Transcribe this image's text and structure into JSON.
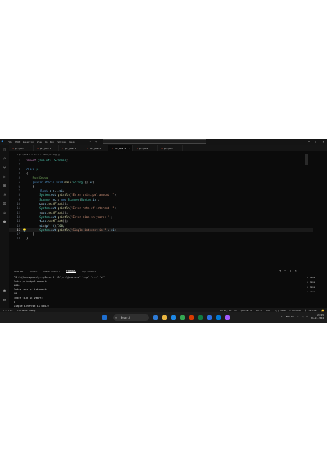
{
  "menu": [
    "File",
    "Edit",
    "Selection",
    "View",
    "Go",
    "Run",
    "Terminal",
    "Help"
  ],
  "tabs": [
    {
      "label": "p1.java"
    },
    {
      "label": "p4.java 1"
    },
    {
      "label": "p3.java 1"
    },
    {
      "label": "p6.java 1"
    },
    {
      "label": "p7.java 1"
    },
    {
      "label": "p5.java"
    },
    {
      "label": "p8.java"
    }
  ],
  "active_tab_index": 4,
  "breadcrumb": "J p7.java > ⚙ p7 > ⊕ main(String[])",
  "code_lines": [
    {
      "n": "1",
      "html": "<span class=\"kw2\">import</span> <span class=\"ty\">java.util.Scanner</span>;"
    },
    {
      "n": "2",
      "html": ""
    },
    {
      "n": "3",
      "html": "<span class=\"kw\">class</span> <span class=\"ty\">p7</span>"
    },
    {
      "n": "4",
      "html": "{"
    },
    {
      "n": "5",
      "html": "    <span class=\"cmt\">Run|Debug</span>"
    },
    {
      "n": "5",
      "html": "    <span class=\"kw\">public static void</span> <span class=\"fn\">main</span>(<span class=\"ty\">String</span> [] <span class=\"var\">ar</span>)"
    },
    {
      "n": "6",
      "html": "    {"
    },
    {
      "n": "7",
      "html": "        <span class=\"kw\">float</span> <span class=\"var\">p</span>,<span class=\"var\">r</span>,<span class=\"var\">t</span>,<span class=\"var\">si</span>;"
    },
    {
      "n": "8",
      "html": "        <span class=\"ty\">System</span>.<span class=\"var\">out</span>.<span class=\"fn\">println</span>(<span class=\"str\">\"Enter principal amount: \"</span>);"
    },
    {
      "n": "9",
      "html": "        <span class=\"ty\">Scanner</span> <span class=\"var\">sc</span> = <span class=\"kw\">new</span> <span class=\"ty\">Scanner</span>(<span class=\"ty\">System</span>.<span class=\"var\">in</span>);"
    },
    {
      "n": "10",
      "html": "        <span class=\"var\">p</span>=<span class=\"var\">sc</span>.<span class=\"fn\">nextFloat</span>();"
    },
    {
      "n": "11",
      "html": "        <span class=\"ty\">System</span>.<span class=\"var\">out</span>.<span class=\"fn\">println</span>(<span class=\"str\">\"Enter rate of interest: \"</span>);"
    },
    {
      "n": "12",
      "html": "        <span class=\"var\">r</span>=<span class=\"var\">sc</span>.<span class=\"fn\">nextFloat</span>();"
    },
    {
      "n": "13",
      "html": "        <span class=\"ty\">System</span>.<span class=\"var\">out</span>.<span class=\"fn\">println</span>(<span class=\"str\">\"Enter time in years: \"</span>);"
    },
    {
      "n": "14",
      "html": "        <span class=\"var\">t</span>=<span class=\"var\">sc</span>.<span class=\"fn\">nextFloat</span>();"
    },
    {
      "n": "15",
      "html": "        <span class=\"var\">si</span>=(<span class=\"var\">p</span>*<span class=\"var\">r</span>*<span class=\"var\">t</span>)/<span class=\"num\">100</span>;"
    },
    {
      "n": "16",
      "html": "        <span class=\"ty\">System</span>.<span class=\"var\">out</span>.<span class=\"fn\">println</span>(<span class=\"str\">\"Simple interest is \"</span> + <span class=\"var\">si</span>);"
    },
    {
      "n": "17",
      "html": "    }"
    },
    {
      "n": "18",
      "html": "}"
    }
  ],
  "current_line_index": 16,
  "panel_tabs": [
    "PROBLEMS",
    "OUTPUT",
    "DEBUG CONSOLE",
    "TERMINAL",
    "SQL CONSOLE"
  ],
  "active_panel_tab_index": 3,
  "terminal_lines": [
    "PS C:\\Users\\Acer\\...\\Java> & 'C:\\...\\java.exe' '-cp' '...' 'p7'",
    "Enter principal amount:",
    "1000",
    "Enter rate of interest:",
    "10",
    "Enter time in years:",
    "5",
    "Simple interest is 500.0",
    "PS C:\\Users\\Acer\\...\\Java> "
  ],
  "terminal_sessions": [
    "Java",
    "Java",
    "Java",
    "Code"
  ],
  "status": {
    "left": [
      "⊗ 0 ⚠ 12",
      "⊙ 0 Java: Ready"
    ],
    "right": [
      "Ln 16, Col 53",
      "Spaces: 4",
      "UTF-8",
      "CRLF",
      "{ } Java",
      "⚙ Go Live",
      "⚲ Prettier",
      "🔔"
    ]
  },
  "taskbar": {
    "search_label": "Search",
    "icon_colors": [
      "#2e7bd6",
      "#e8b441",
      "#1e88e5",
      "#34a853",
      "#d83b01",
      "#107c41",
      "#2f6fe0",
      "#0078d4",
      "#a259ff"
    ],
    "tray_lang": "ENG IN",
    "time": "20:45",
    "date": "06-11-2024"
  }
}
